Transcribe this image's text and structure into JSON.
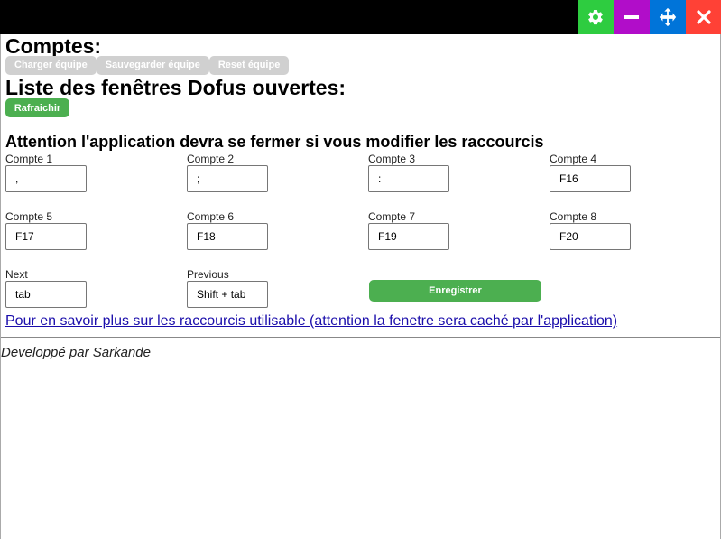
{
  "accounts_title": "Comptes:",
  "account_buttons": {
    "load": "Charger équipe",
    "save": "Sauvegarder équipe",
    "reset": "Reset équipe"
  },
  "windows_title": "Liste des fenêtres Dofus ouvertes:",
  "refresh_label": "Rafraichir",
  "warning": "Attention l'application devra se fermer si vous modifier les raccourcis",
  "shortcuts": {
    "c1": {
      "label": "Compte 1",
      "value": ","
    },
    "c2": {
      "label": "Compte 2",
      "value": ";"
    },
    "c3": {
      "label": "Compte 3",
      "value": ":"
    },
    "c4": {
      "label": "Compte 4",
      "value": "F16"
    },
    "c5": {
      "label": "Compte 5",
      "value": "F17"
    },
    "c6": {
      "label": "Compte 6",
      "value": "F18"
    },
    "c7": {
      "label": "Compte 7",
      "value": "F19"
    },
    "c8": {
      "label": "Compte 8",
      "value": "F20"
    },
    "next": {
      "label": "Next",
      "value": "tab"
    },
    "previous": {
      "label": "Previous",
      "value": "Shift + tab"
    }
  },
  "save_label": "Enregistrer",
  "help_link": "Pour en savoir plus sur les raccourcis utilisable (attention la fenetre sera caché par l'application)",
  "footer": "Developpé par Sarkande",
  "colors": {
    "settings_btn": "#2ecc40",
    "minimize_btn": "#b10dc9",
    "move_btn": "#0074d9",
    "close_btn": "#ff4136",
    "green": "#4caf50"
  }
}
